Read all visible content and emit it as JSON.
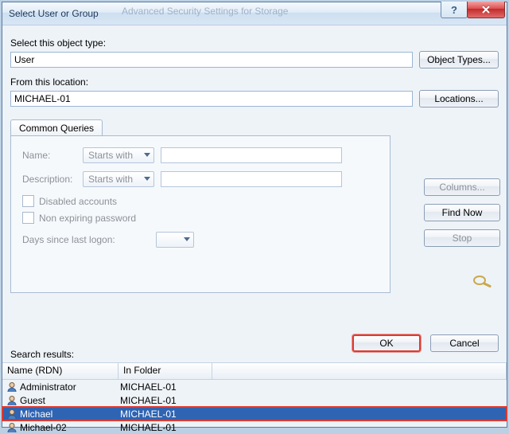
{
  "window": {
    "title": "Select User or Group",
    "ghost_behind": "Advanced Security Settings for Storage"
  },
  "object_type": {
    "label": "Select this object type:",
    "value": "User",
    "button": "Object Types..."
  },
  "location": {
    "label": "From this location:",
    "value": "MICHAEL-01",
    "button": "Locations..."
  },
  "tab": {
    "name": "Common Queries"
  },
  "queries": {
    "name_label": "Name:",
    "name_mode": "Starts with",
    "name_value": "",
    "desc_label": "Description:",
    "desc_mode": "Starts with",
    "desc_value": "",
    "disabled_accounts": "Disabled accounts",
    "non_expiring": "Non expiring password",
    "days_since_label": "Days since last logon:",
    "days_since_value": ""
  },
  "right_buttons": {
    "columns": "Columns...",
    "find_now": "Find Now",
    "stop": "Stop"
  },
  "actions": {
    "ok": "OK",
    "cancel": "Cancel"
  },
  "results": {
    "label": "Search results:",
    "col_name": "Name (RDN)",
    "col_folder": "In Folder",
    "rows": [
      {
        "name": "Administrator",
        "folder": "MICHAEL-01",
        "selected": false
      },
      {
        "name": "Guest",
        "folder": "MICHAEL-01",
        "selected": false
      },
      {
        "name": "Michael",
        "folder": "MICHAEL-01",
        "selected": true
      },
      {
        "name": "Michael-02",
        "folder": "MICHAEL-01",
        "selected": false
      }
    ]
  },
  "icons": {
    "help": "?",
    "close": "×"
  }
}
